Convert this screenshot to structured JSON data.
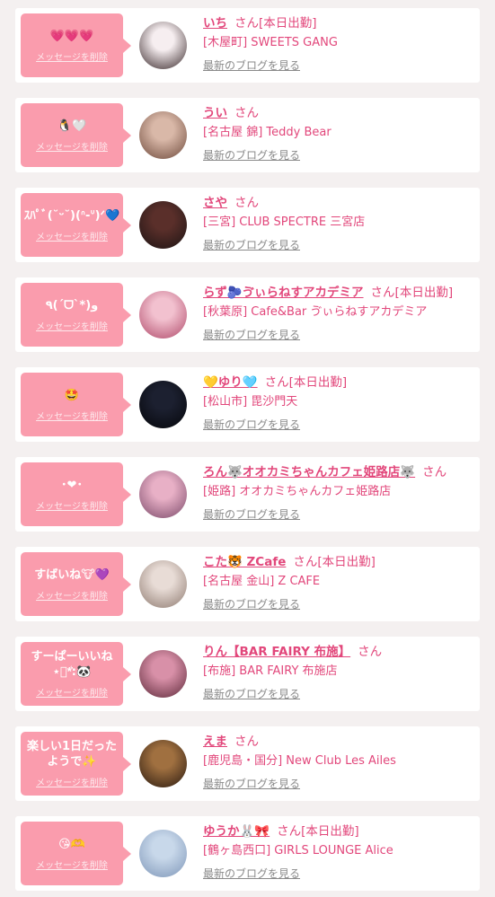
{
  "cards": [
    {
      "message": "💗💗💗",
      "delete_label": "メッセージを削除",
      "name": "いち",
      "suffix": "さん[本日出勤]",
      "shop": "[木屋町] SWEETS GANG",
      "blog_label": "最新のブログを見る",
      "avatar_colors": [
        "#f6eef0",
        "#3a2a2c"
      ]
    },
    {
      "message": "🐧🤍",
      "delete_label": "メッセージを削除",
      "name": "うい",
      "suffix": "さん",
      "shop": "[名古屋 錦] Teddy Bear",
      "blog_label": "最新のブログを見る",
      "avatar_colors": [
        "#d9b8a8",
        "#6e4a3c"
      ]
    },
    {
      "message": "ｽﾊﾟﾞ(˘ᵕ˘)(ᐢ-ᐡ)ᐟ💙",
      "delete_label": "メッセージを削除",
      "name": "さや",
      "suffix": "さん",
      "shop": "[三宮] CLUB SPECTRE 三宮店",
      "blog_label": "最新のブログを見る",
      "avatar_colors": [
        "#5a2f2a",
        "#1c1414"
      ]
    },
    {
      "message": "٩(ˊᗜˋ*)و",
      "delete_label": "メッセージを削除",
      "name": "らず🫐ゔぃらねすアカデミア",
      "suffix": "さん[本日出勤]",
      "shop": "[秋葉原] Cafe&Bar ゔぃらねすアカデミア",
      "blog_label": "最新のブログを見る",
      "avatar_colors": [
        "#f2c1cf",
        "#b04a6a"
      ]
    },
    {
      "message": "🤩",
      "delete_label": "メッセージを削除",
      "name": "💛ゆり🩵",
      "suffix": "さん[本日出勤]",
      "shop": "[松山市] 毘沙門天",
      "blog_label": "最新のブログを見る",
      "avatar_colors": [
        "#1c2030",
        "#05060a"
      ]
    },
    {
      "message": "･❤︎･",
      "delete_label": "メッセージを削除",
      "name": "ろん🐺オオカミちゃんカフェ姫路店🐺",
      "suffix": "さん",
      "shop": "[姫路] オオカミちゃんカフェ姫路店",
      "blog_label": "最新のブログを見る",
      "avatar_colors": [
        "#e8b0c6",
        "#7b4a6a"
      ]
    },
    {
      "message": "すばいね🐮💜",
      "delete_label": "メッセージを削除",
      "name": "こた🐯 ZCafe",
      "suffix": "さん[本日出勤]",
      "shop": "[名古屋 金山] Z CAFE",
      "blog_label": "最新のブログを見る",
      "avatar_colors": [
        "#e8dcd6",
        "#8e7a70"
      ]
    },
    {
      "message": "すーぱーいいね⋆͛*͛:🐼",
      "delete_label": "メッセージを削除",
      "name": "りん【BAR FAIRY 布施】",
      "suffix": "さん",
      "shop": "[布施] BAR FAIRY 布施店",
      "blog_label": "最新のブログを見る",
      "avatar_colors": [
        "#d890a8",
        "#5e2a3a"
      ]
    },
    {
      "message": "楽しい1日だったようで✨",
      "delete_label": "メッセージを削除",
      "name": "えま",
      "suffix": "さん",
      "shop": "[鹿児島・国分] New Club Les Ailes",
      "blog_label": "最新のブログを見る",
      "avatar_colors": [
        "#a07040",
        "#2a1a10"
      ]
    },
    {
      "message": "😘🫶",
      "delete_label": "メッセージを削除",
      "name": "ゆうか🐰🎀",
      "suffix": "さん[本日出勤]",
      "shop": "[鶴ヶ島西口] GIRLS LOUNGE Alice",
      "blog_label": "最新のブログを見る",
      "avatar_colors": [
        "#c8d8ea",
        "#7e96b8"
      ]
    }
  ]
}
